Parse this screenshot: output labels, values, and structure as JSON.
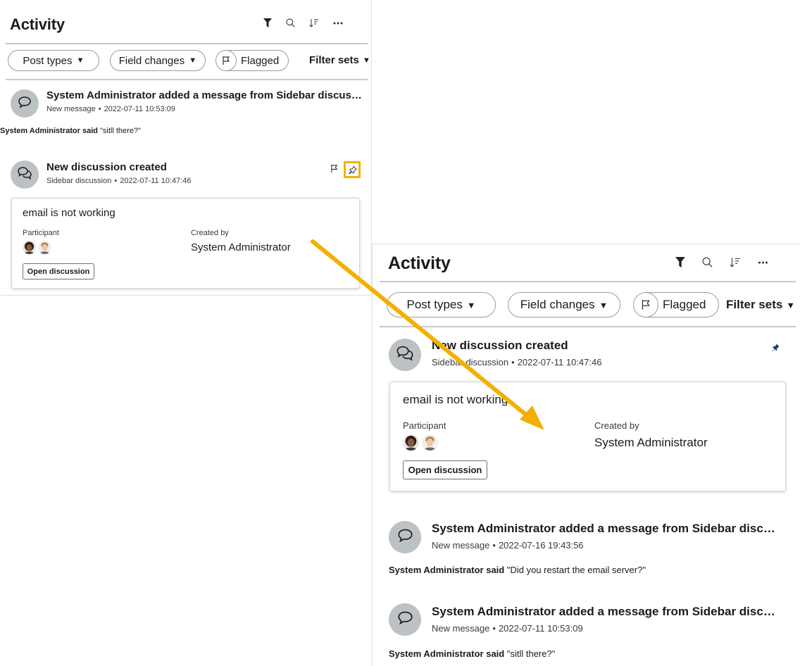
{
  "header": {
    "title": "Activity",
    "icons": [
      "filter-icon",
      "search-icon",
      "sort-icon",
      "more-icon"
    ]
  },
  "filters": {
    "post_types": "Post types",
    "field_changes": "Field changes",
    "flagged": "Flagged",
    "filter_sets": "Filter sets"
  },
  "before": {
    "message_entry": {
      "title": "System Administrator added a message from Sidebar discussion",
      "kind": "New message",
      "timestamp": "2022-07-11 10:53:09",
      "author": "System Administrator said",
      "quote": "\"sitll there?\""
    },
    "discussion_entry": {
      "title": "New discussion created",
      "kind": "Sidebar discussion",
      "timestamp": "2022-07-11 10:47:46"
    }
  },
  "after": {
    "discussion_entry": {
      "title": "New discussion created",
      "kind": "Sidebar discussion",
      "timestamp": "2022-07-11 10:47:46"
    },
    "message_entries": [
      {
        "title": "System Administrator added a message from Sidebar discussion",
        "kind": "New message",
        "timestamp": "2022-07-16 19:43:56",
        "author": "System Administrator said",
        "quote": "\"Did you restart the email server?\""
      },
      {
        "title": "System Administrator added a message from Sidebar discussion",
        "kind": "New message",
        "timestamp": "2022-07-11 10:53:09",
        "author": "System Administrator said",
        "quote": "\"sitll there?\""
      }
    ]
  },
  "discussion_card": {
    "title": "email is not working",
    "participant_label": "Participant",
    "created_by_label": "Created by",
    "created_by": "System Administrator",
    "open_button": "Open discussion"
  },
  "colors": {
    "highlight": "#f3b000",
    "arrow": "#f3b000",
    "pin": "#1f3a6e",
    "avatar_bg": "#bcc1c4"
  }
}
